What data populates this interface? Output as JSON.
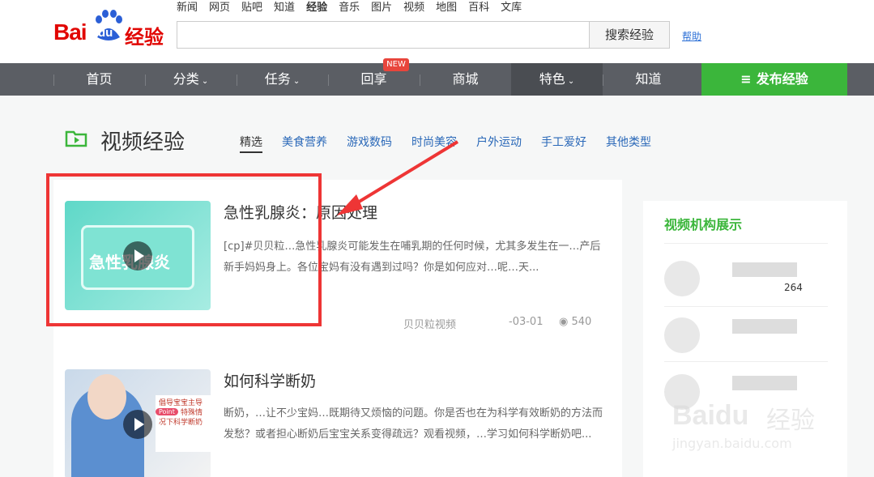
{
  "logo": {
    "brand": "Bai",
    "du": "du",
    "product": "经验"
  },
  "top_nav": [
    "新闻",
    "网页",
    "贴吧",
    "知道",
    "经验",
    "音乐",
    "图片",
    "视频",
    "地图",
    "百科",
    "文库"
  ],
  "search": {
    "value": "",
    "button_label": "搜索经验",
    "help_label": "帮助"
  },
  "main_nav": {
    "items": [
      {
        "label": "首页",
        "caret": false
      },
      {
        "label": "分类",
        "caret": true
      },
      {
        "label": "任务",
        "caret": true
      },
      {
        "label": "回享",
        "caret": false
      },
      {
        "label": "商城",
        "caret": false
      },
      {
        "label": "特色",
        "caret": true
      },
      {
        "label": "知道",
        "caret": false
      }
    ],
    "new_badge": "NEW",
    "publish_label": "发布经验"
  },
  "section": {
    "title": "视频经验",
    "tabs": [
      "精选",
      "美食营养",
      "游戏数码",
      "时尚美容",
      "户外运动",
      "手工爱好",
      "其他类型"
    ]
  },
  "articles": [
    {
      "title": "急性乳腺炎：原因处理",
      "desc": "[cp]#贝贝粒…急性乳腺炎可能发生在哺乳期的任何时候，尤其多发生在一…产后新手妈妈身上。各位宝妈有没有遇到过吗？你是如何应对…呢…天...",
      "thumb_text": "急性乳腺炎",
      "author": "贝贝粒视频",
      "date": "-03-01",
      "views": "540"
    },
    {
      "title": "如何科学断奶",
      "desc": "断奶，…让不少宝妈…既期待又烦恼的问题。你是否也在为科学有效断奶的方法而发愁？或者担心断奶后宝宝关系变得疏远？观看视频，…学习如何科学断奶吧...",
      "thumb_point": "Point",
      "thumb_text": "倡导宝宝主导的乳，特殊情况下科学断奶"
    }
  ],
  "sidebar": {
    "title": "视频机构展示",
    "items": [
      {
        "count": "264"
      },
      {
        "count": ""
      },
      {
        "count": ""
      }
    ]
  },
  "watermark": {
    "brand": "Baidu",
    "product": "经验",
    "url": "jingyan.baidu.com"
  },
  "colors": {
    "accent_green": "#3bb63b",
    "brand_red": "#e10602",
    "nav_gray": "#5b5e64",
    "highlight_red": "#ee3535"
  }
}
